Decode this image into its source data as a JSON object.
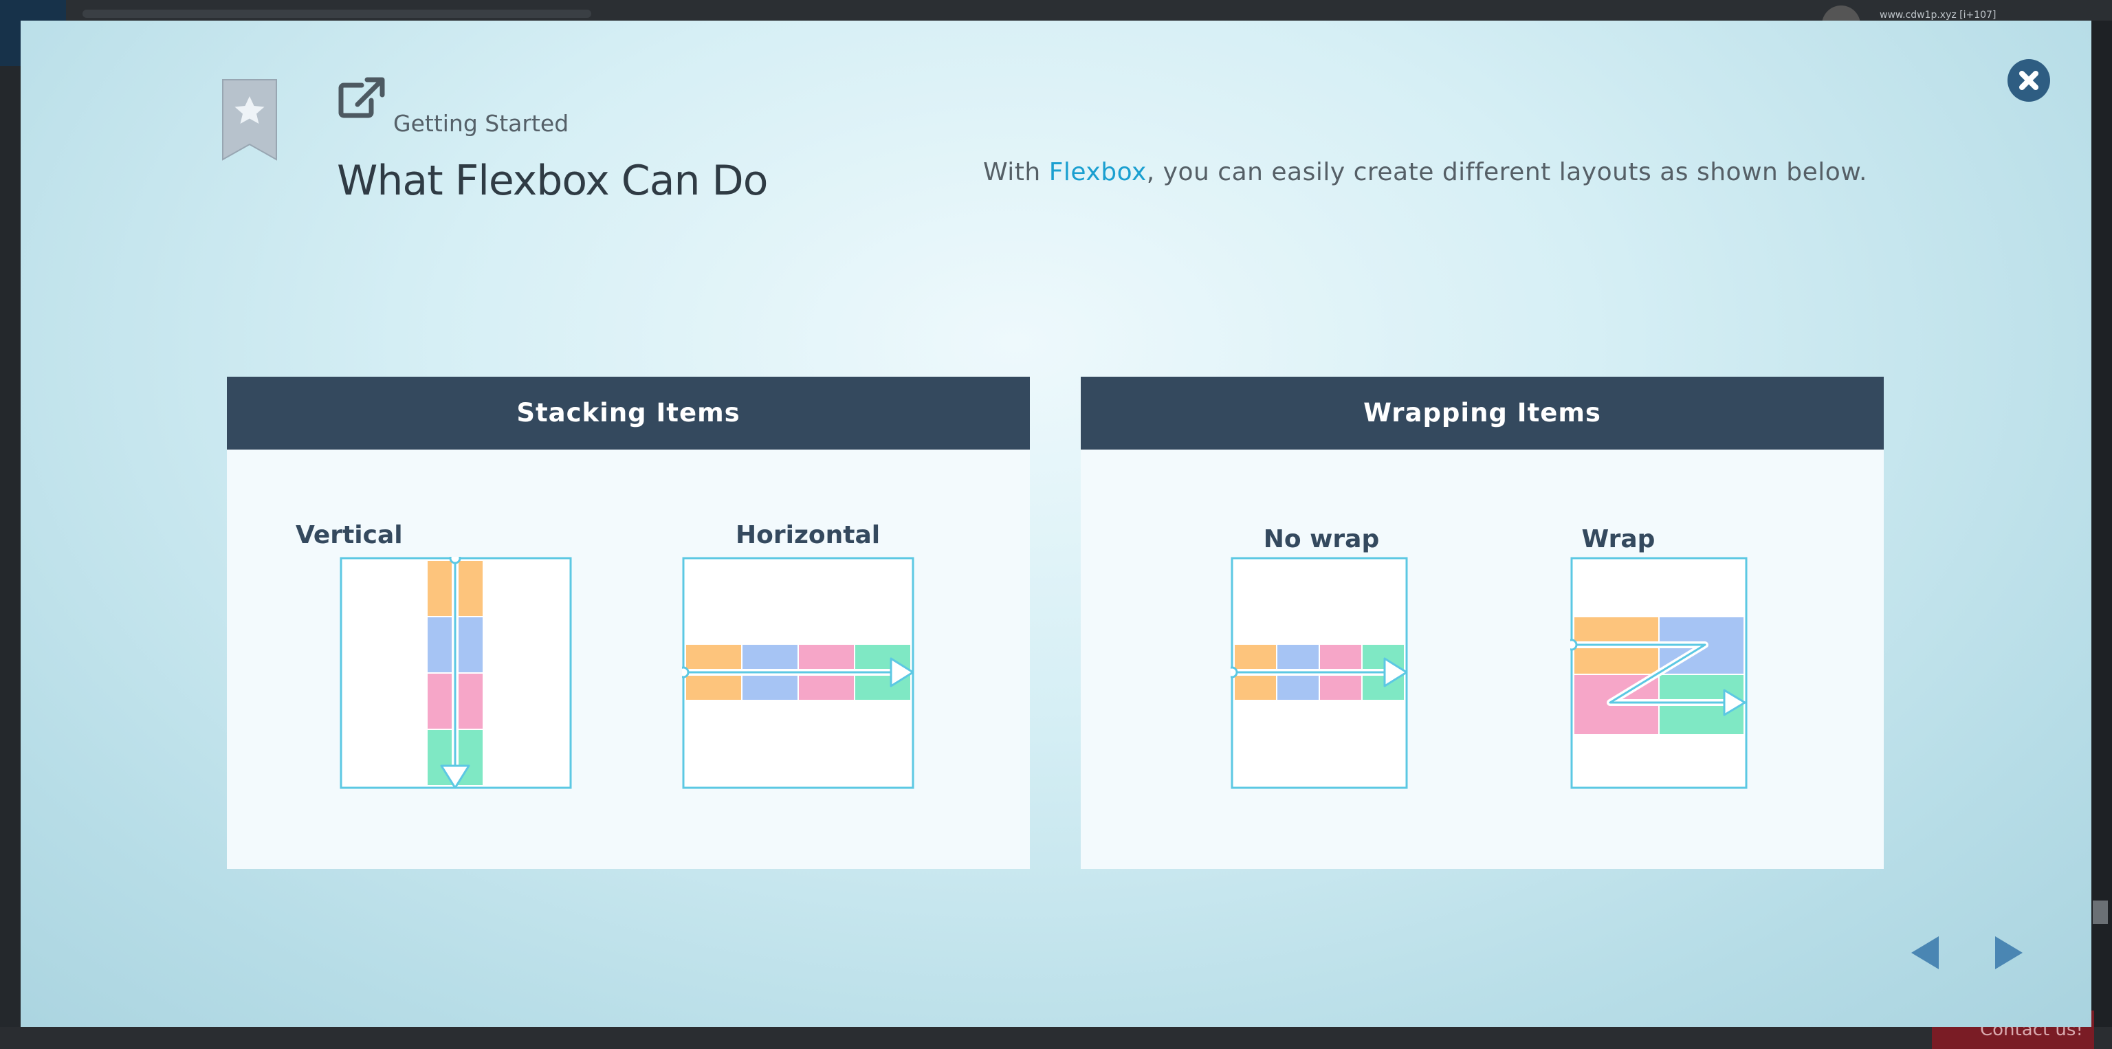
{
  "header": {
    "eyebrow": "Getting Started",
    "title": "What Flexbox Can Do",
    "intro_prefix": "With ",
    "intro_link": "Flexbox",
    "intro_suffix": ", you can easily create different layouts as shown below."
  },
  "cards": [
    {
      "title": "Stacking Items",
      "diagrams": [
        {
          "label": "Vertical"
        },
        {
          "label": "Horizontal"
        }
      ]
    },
    {
      "title": "Wrapping Items",
      "diagrams": [
        {
          "label": "No wrap"
        },
        {
          "label": "Wrap"
        }
      ]
    }
  ],
  "background": {
    "user_text": "www.cdw1p.xyz [i+107]",
    "contact_label": "Contact us!"
  },
  "colors": {
    "header_bar": "#34495e",
    "link": "#1a9fd0",
    "item_orange": "#fdc47c",
    "item_blue": "#a6c4f4",
    "item_pink": "#f6a6c8",
    "item_green": "#7fe8c4",
    "frame": "#5cc8e3",
    "close_button": "#2e5d82"
  },
  "icons": {
    "bookmark": "bookmark-star-icon",
    "external": "external-link-icon",
    "close": "close-icon",
    "prev": "chevron-left-icon",
    "next": "chevron-right-icon"
  }
}
